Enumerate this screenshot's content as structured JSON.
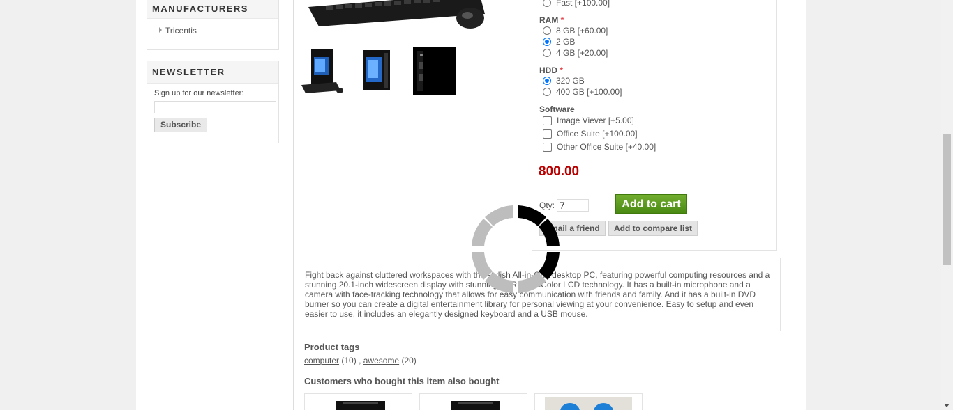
{
  "sidebar": {
    "manufacturers": {
      "title": "Manufacturers",
      "items": [
        "Tricentis"
      ]
    },
    "newsletter": {
      "title": "Newsletter",
      "label": "Sign up for our newsletter:",
      "input_value": "",
      "button": "Subscribe"
    }
  },
  "product": {
    "options_top": {
      "label": "Fast [+100.00]"
    },
    "ram": {
      "label": "RAM",
      "required": "*",
      "options": [
        "8 GB [+60.00]",
        "2 GB",
        "4 GB [+20.00]"
      ],
      "selected": "2 GB"
    },
    "hdd": {
      "label": "HDD",
      "required": "*",
      "options": [
        "320 GB",
        "400 GB [+100.00]"
      ],
      "selected": "320 GB"
    },
    "software": {
      "label": "Software",
      "options": [
        "Image Viever [+5.00]",
        "Office Suite [+100.00]",
        "Other Office Suite [+40.00]"
      ]
    },
    "price": "800.00",
    "qty_label": "Qty:",
    "qty_value": "7",
    "add_to_cart": "Add to cart",
    "email_friend": "Email a friend",
    "compare": "Add to compare list",
    "description": "Fight back against cluttered workspaces with the stylish All-in-One desktop PC, featuring powerful computing resources and a stunning 20.1-inch widescreen display with stunning XBRITE-HiColor LCD technology. It has a built-in microphone and a camera with face-tracking technology that allows for easy communication with friends and family. And it has a built-in DVD burner so you can create a digital entertainment library for personal viewing at your convenience. Easy to setup and even easier to use, it includes an elegantly designed keyboard and a USB mouse.",
    "tags_title": "Product tags",
    "tags": [
      {
        "name": "computer",
        "count": "(10)"
      },
      {
        "name": "awesome",
        "count": "(20)"
      }
    ],
    "tag_separator": ",",
    "also_bought_title": "Customers who bought this item also bought"
  },
  "colors": {
    "price": "#b80000",
    "cart_button": "#5e9b1e",
    "radio_checked": "#0075ff"
  },
  "icons": {
    "loading": "loading-spinner-icon"
  }
}
